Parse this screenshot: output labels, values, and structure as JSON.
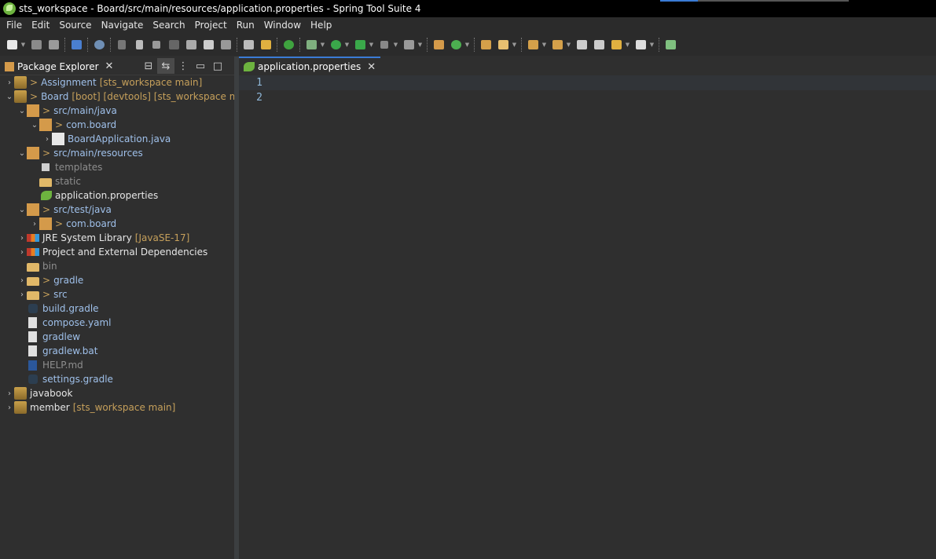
{
  "window": {
    "title": "sts_workspace - Board/src/main/resources/application.properties - Spring Tool Suite 4"
  },
  "menu": {
    "items": [
      "File",
      "Edit",
      "Source",
      "Navigate",
      "Search",
      "Project",
      "Run",
      "Window",
      "Help"
    ]
  },
  "package_explorer": {
    "tab_label": "Package Explorer",
    "tree": [
      {
        "label": "Assignment",
        "decoration": "[sts_workspace main]"
      },
      {
        "label": "Board",
        "decoration": "[boot] [devtools] [sts_workspace main]"
      },
      {
        "label": "src/main/java"
      },
      {
        "label": "com.board"
      },
      {
        "label": "BoardApplication.java"
      },
      {
        "label": "src/main/resources"
      },
      {
        "label": "templates"
      },
      {
        "label": "static"
      },
      {
        "label": "application.properties"
      },
      {
        "label": "src/test/java"
      },
      {
        "label": "com.board"
      },
      {
        "label": "JRE System Library",
        "decoration": "[JavaSE-17]"
      },
      {
        "label": "Project and External Dependencies"
      },
      {
        "label": "bin"
      },
      {
        "label": "gradle"
      },
      {
        "label": "src"
      },
      {
        "label": "build.gradle"
      },
      {
        "label": "compose.yaml"
      },
      {
        "label": "gradlew"
      },
      {
        "label": "gradlew.bat"
      },
      {
        "label": "HELP.md"
      },
      {
        "label": "settings.gradle"
      },
      {
        "label": "javabook"
      },
      {
        "label": "member",
        "decoration": "[sts_workspace main]"
      }
    ]
  },
  "editor": {
    "tab_label": "application.properties",
    "line_numbers": [
      "1",
      "2"
    ]
  },
  "colors": {
    "accent": "#3a7bd5",
    "spring_green": "#6db33f",
    "decoration": "#c6a05b",
    "background": "#2f2f2f"
  }
}
